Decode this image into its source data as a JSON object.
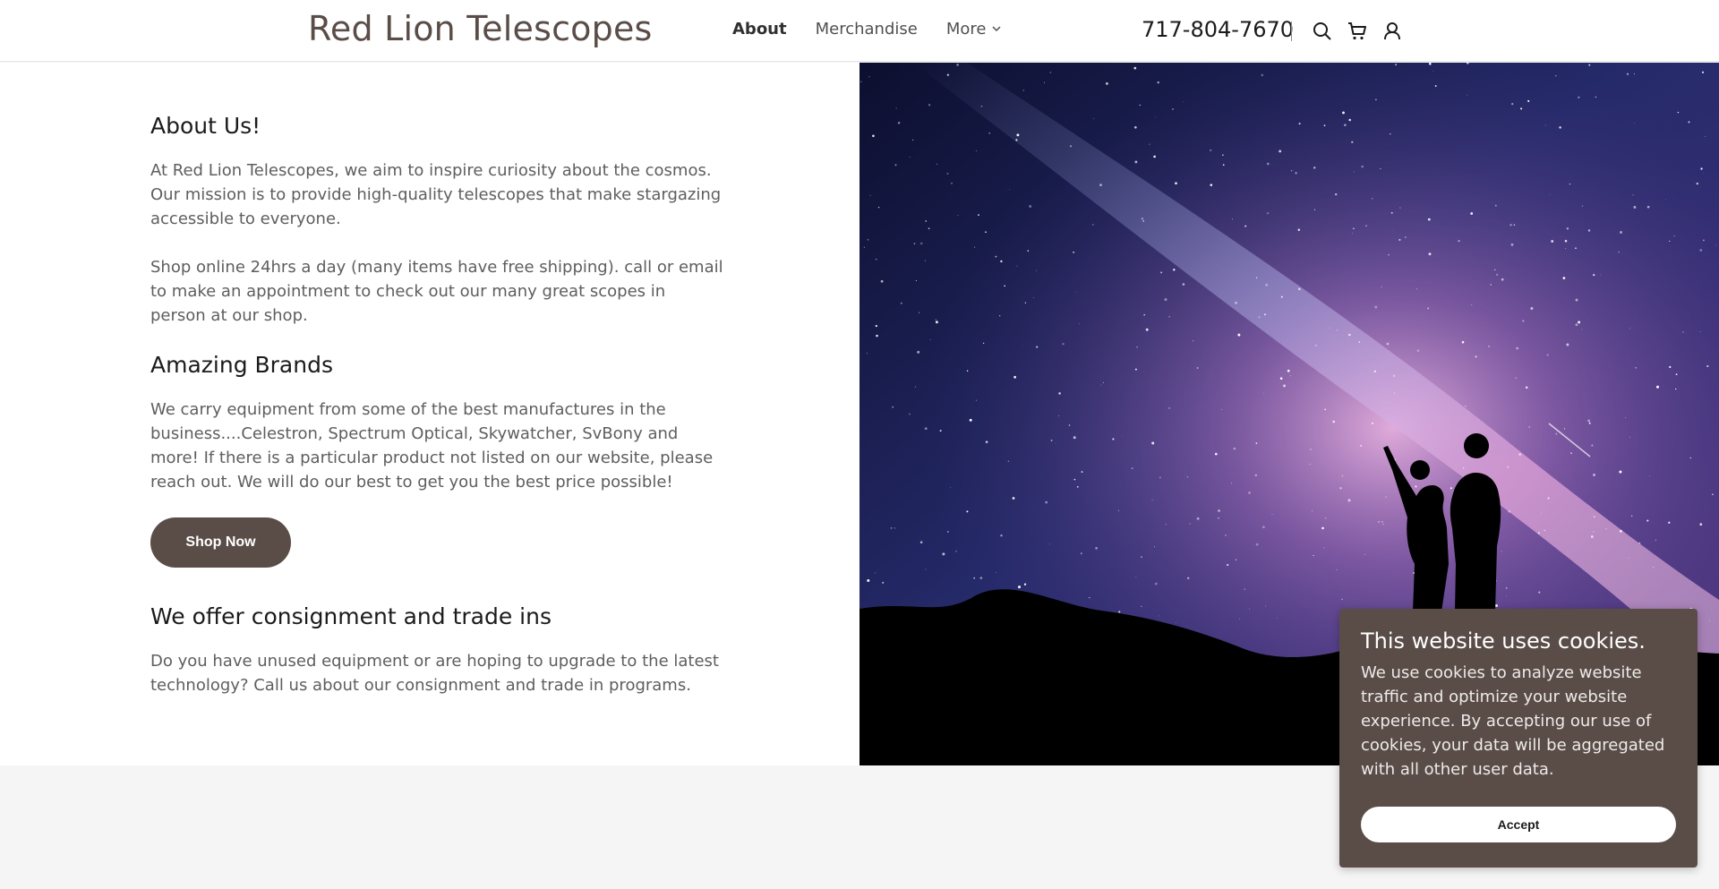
{
  "header": {
    "site_title": "Red Lion Telescopes",
    "nav": [
      {
        "label": "About",
        "active": true
      },
      {
        "label": "Merchandise",
        "active": false
      },
      {
        "label": "More",
        "active": false
      }
    ],
    "phone": "717-804-7670",
    "icons": [
      "search-icon",
      "cart-icon",
      "account-icon",
      "chevron-down-icon"
    ]
  },
  "main": {
    "sections": [
      {
        "heading": "About Us!",
        "paragraphs": [
          "At Red Lion Telescopes, we aim to inspire curiosity about the cosmos. Our mission is to provide high-quality telescopes that make stargazing accessible to everyone.",
          "Shop online 24hrs a day (many items have free shipping). call or email to make an appointment to check out our many great scopes in person at our shop."
        ]
      },
      {
        "heading": "Amazing Brands",
        "paragraphs": [
          "We carry equipment from some of the best manufactures in the business....Celestron, Spectrum Optical, Skywatcher, SvBony and more! If there is a particular product not listed on our website, please reach out. We will do our best to get you the best price possible!"
        ],
        "button": "Shop Now"
      },
      {
        "heading": "We offer consignment and trade ins",
        "paragraphs": [
          "Do you have unused equipment or are hoping to upgrade to the latest technology? Call us about our consignment and trade in programs."
        ]
      }
    ]
  },
  "cookie_banner": {
    "title": "This website uses cookies.",
    "body": "We use cookies to analyze website traffic and optimize your website experience. By accepting our use of cookies, your data will be aggregated with all other user data.",
    "accept_label": "Accept"
  },
  "colors": {
    "brand": "#5a4d48",
    "text": "#1b1b1b",
    "muted": "#5e5e5e",
    "footer_bg": "#f5f5f5"
  }
}
